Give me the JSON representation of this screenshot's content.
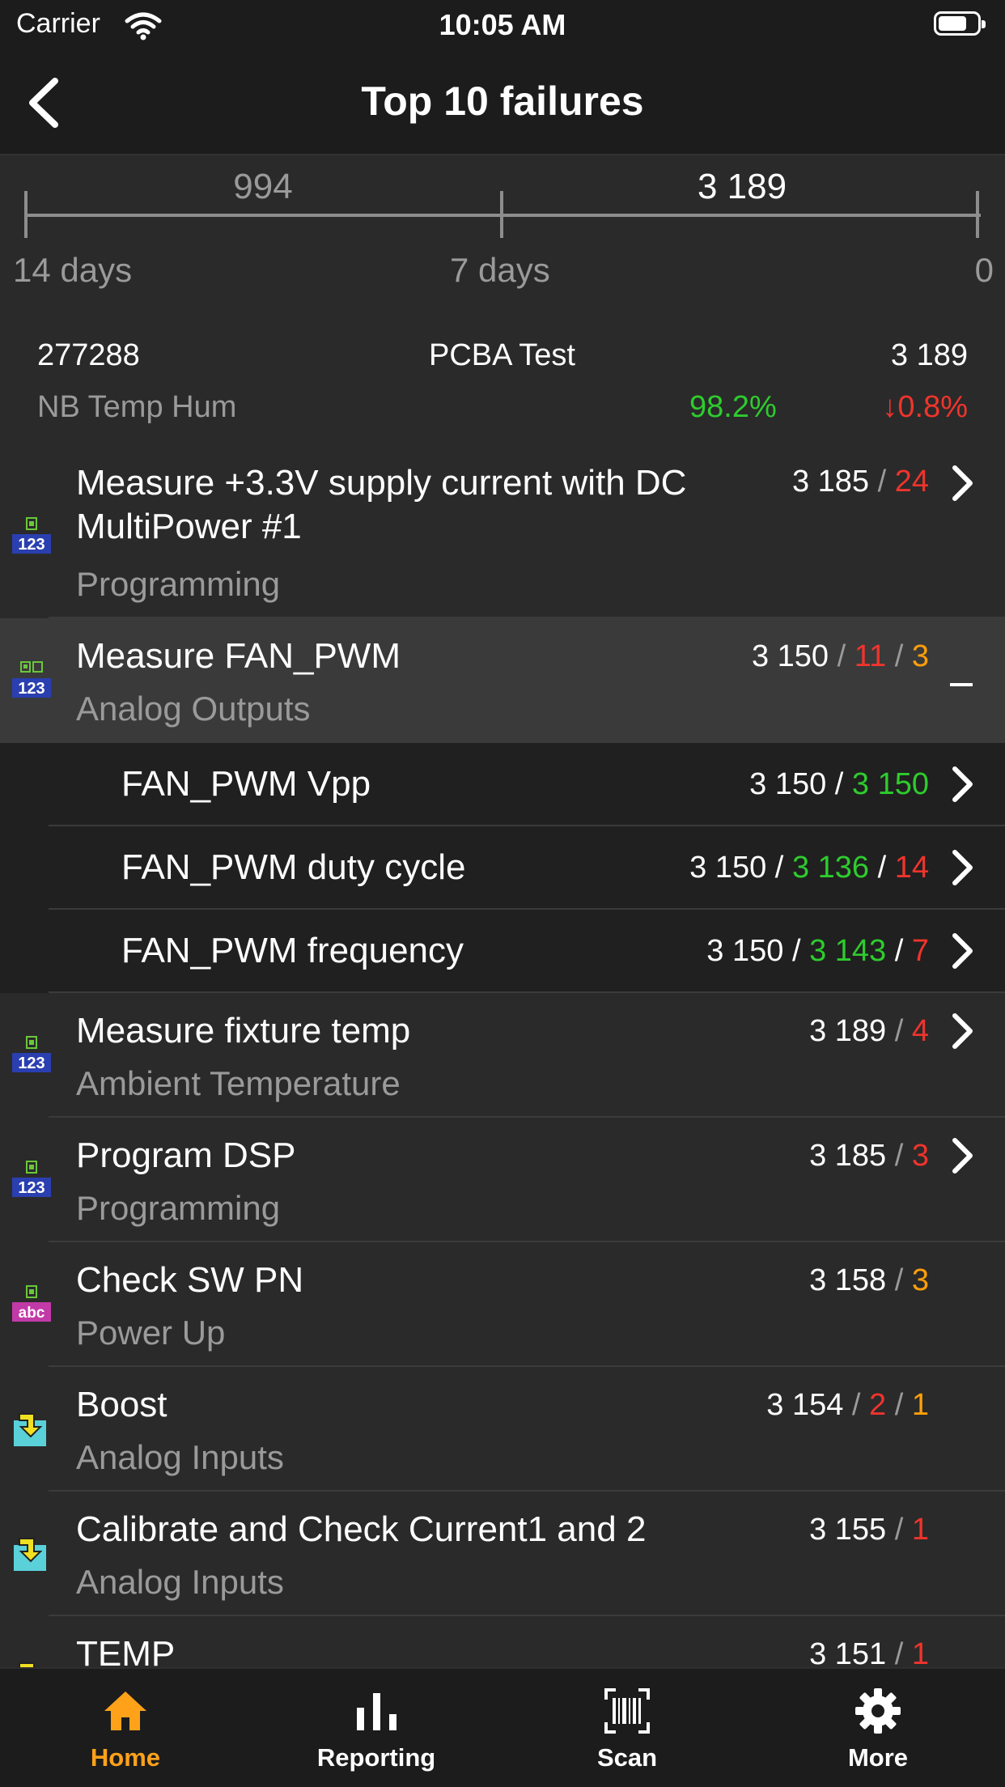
{
  "status_bar": {
    "carrier": "Carrier",
    "time": "10:05 AM"
  },
  "nav": {
    "title": "Top 10 failures",
    "back_icon": "chevron-left-icon"
  },
  "timeline": {
    "left_count": "994",
    "right_count": "3 189",
    "labels": {
      "start": "14 days",
      "mid": "7 days",
      "end": "0"
    }
  },
  "summary": {
    "id": "277288",
    "station": "PCBA Test",
    "total": "3 189",
    "product": "NB Temp Hum",
    "yield": "98.2%",
    "change": "↓0.8%"
  },
  "list": [
    {
      "icon": "numeric-test-icon",
      "title": "Measure +3.3V supply current with DC MultiPower #1",
      "subtitle": "Programming",
      "stats": [
        [
          "3 185",
          "w"
        ],
        [
          "24",
          "r"
        ]
      ],
      "action": "chevron"
    },
    {
      "icon": "multi-numeric-test-icon",
      "title": "Measure FAN_PWM",
      "subtitle": "Analog Outputs",
      "stats": [
        [
          "3 150",
          "w"
        ],
        [
          "11",
          "r"
        ],
        [
          "3",
          "o"
        ]
      ],
      "action": "collapse"
    },
    {
      "title": "FAN_PWM Vpp",
      "stats": [
        [
          "3 150",
          "w"
        ],
        [
          "3 150",
          "g"
        ]
      ],
      "action": "chevron"
    },
    {
      "title": "FAN_PWM duty cycle",
      "stats": [
        [
          "3 150",
          "w"
        ],
        [
          "3 136",
          "g"
        ],
        [
          "14",
          "r"
        ]
      ],
      "action": "chevron"
    },
    {
      "title": "FAN_PWM frequency",
      "stats": [
        [
          "3 150",
          "w"
        ],
        [
          "3 143",
          "g"
        ],
        [
          "7",
          "r"
        ]
      ],
      "action": "chevron"
    },
    {
      "icon": "numeric-test-icon",
      "title": "Measure fixture temp",
      "subtitle": "Ambient Temperature",
      "stats": [
        [
          "3 189",
          "w"
        ],
        [
          "4",
          "r"
        ]
      ],
      "action": "chevron"
    },
    {
      "icon": "numeric-test-icon",
      "title": "Program DSP",
      "subtitle": "Programming",
      "stats": [
        [
          "3 185",
          "w"
        ],
        [
          "3",
          "r"
        ]
      ],
      "action": "chevron"
    },
    {
      "icon": "string-test-icon",
      "title": "Check SW PN",
      "subtitle": "Power Up",
      "stats": [
        [
          "3 158",
          "w"
        ],
        [
          "3",
          "o"
        ]
      ]
    },
    {
      "icon": "action-step-icon",
      "title": "Boost",
      "subtitle": "Analog Inputs",
      "stats": [
        [
          "3 154",
          "w"
        ],
        [
          "2",
          "r"
        ],
        [
          "1",
          "o"
        ]
      ]
    },
    {
      "icon": "action-step-icon",
      "title": "Calibrate and Check Current1 and 2",
      "subtitle": "Analog Inputs",
      "stats": [
        [
          "3 155",
          "w"
        ],
        [
          "1",
          "r"
        ]
      ]
    },
    {
      "icon": "action-step-icon",
      "title": "TEMP",
      "subtitle": "",
      "stats": [
        [
          "3 151",
          "w"
        ],
        [
          "1",
          "r"
        ]
      ]
    }
  ],
  "tabs": [
    {
      "label": "Home",
      "icon": "home-icon"
    },
    {
      "label": "Reporting",
      "icon": "bar-chart-icon"
    },
    {
      "label": "Scan",
      "icon": "barcode-scan-icon"
    },
    {
      "label": "More",
      "icon": "gear-icon"
    }
  ],
  "colors": {
    "accent": "#ffa21a",
    "pass": "#2ecc2e",
    "fail": "#f0342c",
    "warn": "#ff9f0a"
  }
}
